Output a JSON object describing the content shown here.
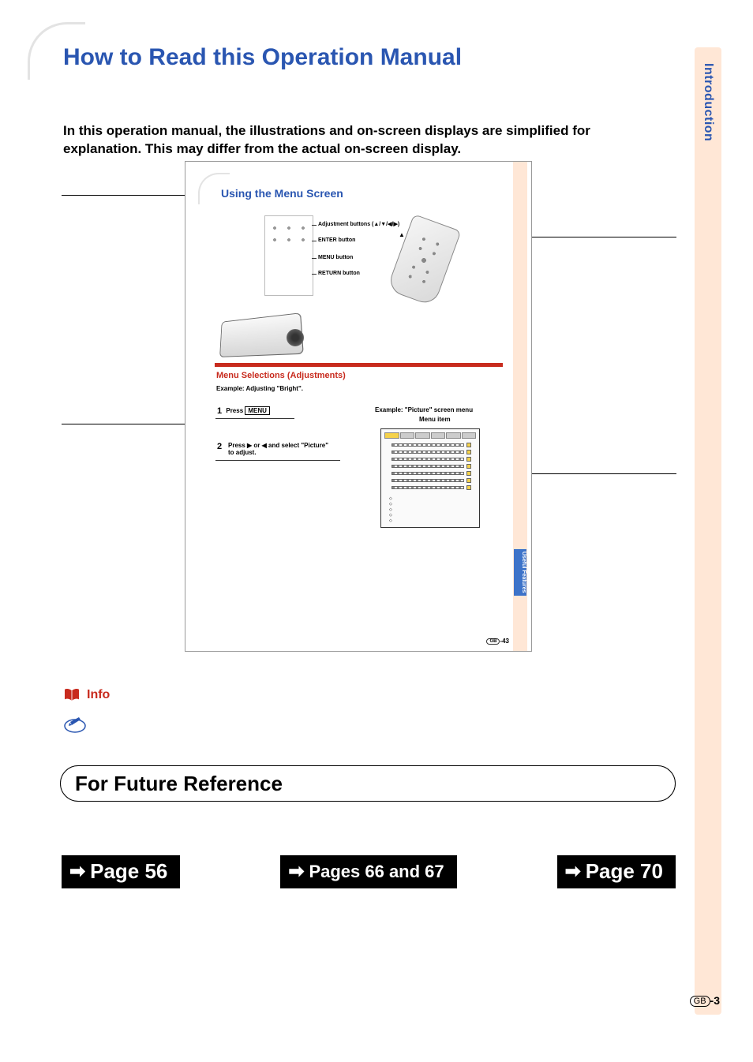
{
  "side_tab": "Introduction",
  "title": "How to Read this Operation Manual",
  "intro": "In this operation manual, the illustrations and on-screen displays are simplified for explanation. This may differ from the actual on-screen display.",
  "inset": {
    "title": "Using the Menu Screen",
    "side_tab": "Useful Features",
    "callouts": {
      "adjustment": "Adjustment buttons (▲/▼/◀/▶)",
      "enter": "ENTER button",
      "menu": "MENU button",
      "return": "RETURN button"
    },
    "dpad": "▲▼◀▶",
    "section_heading": "Menu Selections (Adjustments)",
    "example_intro": "Example: Adjusting \"Bright\".",
    "step1_prefix": "Press",
    "step1_menu": "MENU",
    "step2": "Press ▶ or ◀ and select \"Picture\" to adjust.",
    "screen_caption1": "Example: \"Picture\" screen menu",
    "screen_caption2": "Menu item",
    "pager_gb": "GB",
    "pager_num": "-43"
  },
  "info_label": "Info",
  "ffr_title": "For Future Reference",
  "btn1": "Page 56",
  "btn2": "Pages 66 and 67",
  "btn3": "Page 70",
  "footer_gb": "GB",
  "footer_num": "-3"
}
